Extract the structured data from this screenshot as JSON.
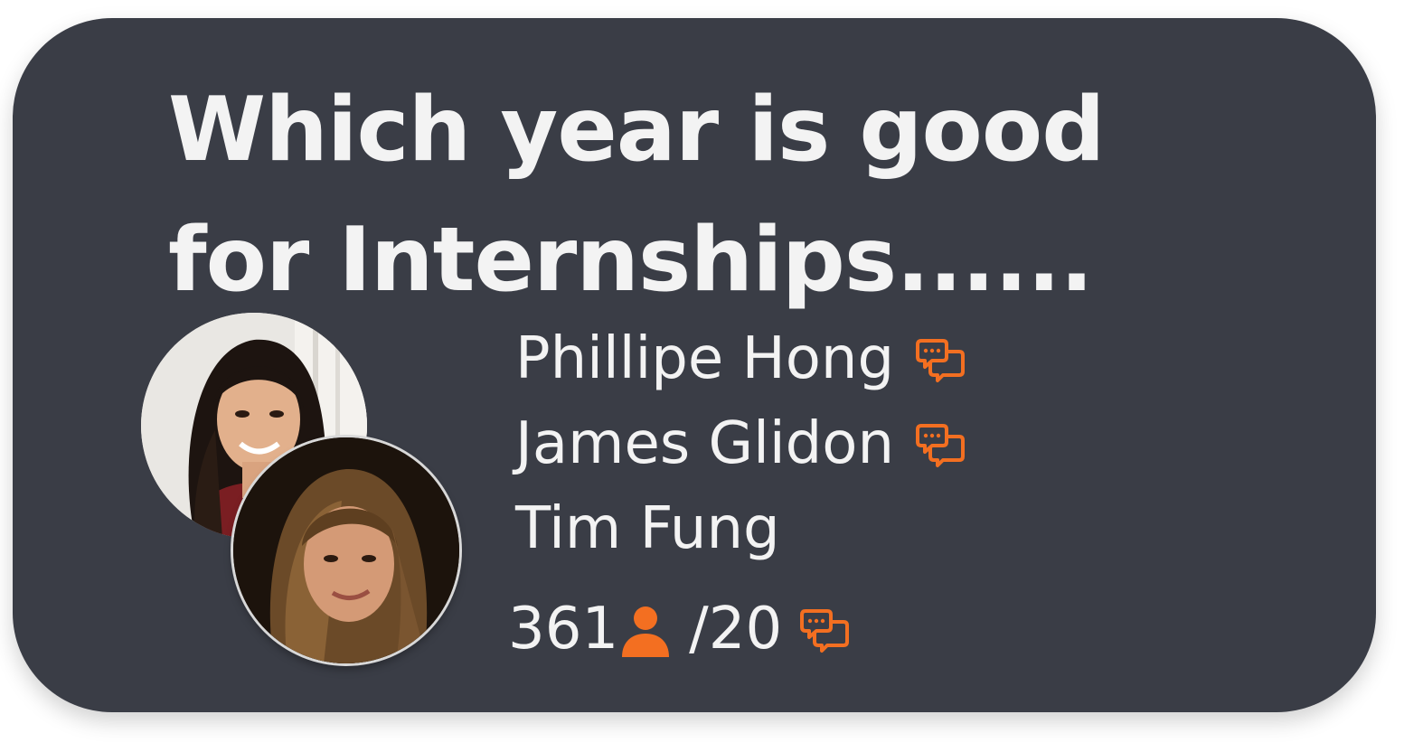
{
  "card": {
    "title": "Which year is good for Internships......",
    "participants": [
      {
        "name": "Phillipe Hong",
        "has_chat_icon": true
      },
      {
        "name": "James Glidon",
        "has_chat_icon": true
      },
      {
        "name": "Tim Fung",
        "has_chat_icon": false
      }
    ],
    "stats": {
      "members": "361",
      "members_icon": "person-icon",
      "messages": "/20",
      "messages_icon": "chat-icon"
    }
  },
  "colors": {
    "card_background": "#3a3d46",
    "text": "#f3f3f3",
    "accent": "#f36f21"
  },
  "icons": {
    "chat": "chat-bubbles-icon",
    "person": "person-icon"
  }
}
